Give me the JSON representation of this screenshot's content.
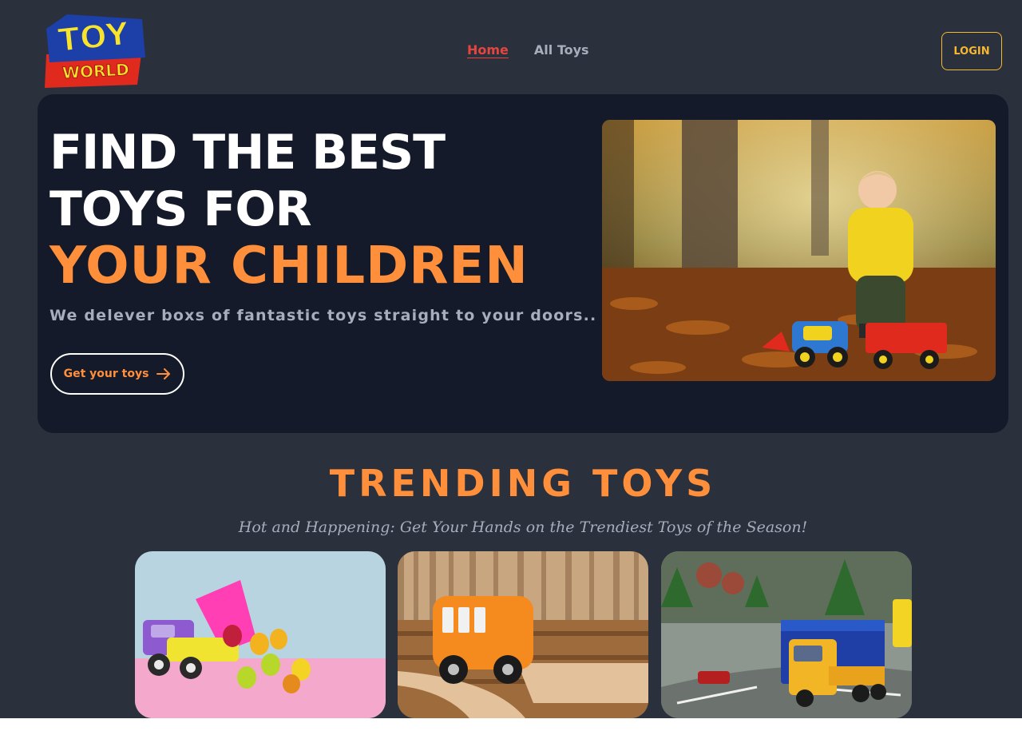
{
  "brand": {
    "logo_line1": "TOY",
    "logo_line2": "WORLD"
  },
  "nav": {
    "items": [
      {
        "label": "Home",
        "active": true
      },
      {
        "label": "All Toys",
        "active": false
      }
    ],
    "login_label": "LOGIN"
  },
  "hero": {
    "title_line1": "FIND THE BEST",
    "title_line2": "TOYS FOR",
    "title_line3": "YOUR CHILDREN",
    "subtitle": "We delever boxs of fantastic toys straight to your doors..",
    "cta_label": "Get your toys",
    "cta_icon": "arrow-right-icon"
  },
  "trending": {
    "title": "TRENDING TOYS",
    "subtitle": "Hot and Happening: Get Your Hands on the Trendiest Toys of the Season!",
    "cards": [
      {
        "name": "gummy-truck"
      },
      {
        "name": "wooden-bus"
      },
      {
        "name": "toy-dump-truck"
      }
    ]
  },
  "colors": {
    "page_bg": "#2a303c",
    "hero_bg": "#141a29",
    "accent_orange": "#ff8f3a",
    "active_nav": "#e4463f",
    "login_border": "#f7b731",
    "muted_text": "#a6adbb"
  }
}
